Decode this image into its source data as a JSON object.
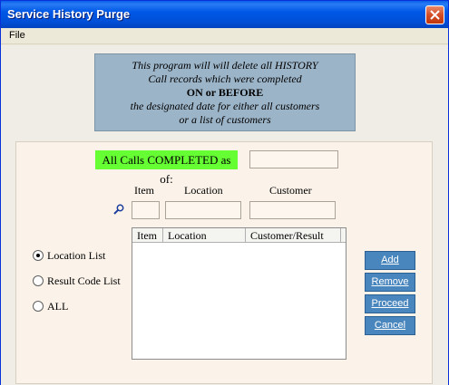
{
  "window": {
    "title": "Service History Purge"
  },
  "menu": {
    "file": "File"
  },
  "info": {
    "line1": "This program will will delete all HISTORY",
    "line2": "Call records which were completed",
    "line3": "ON or BEFORE",
    "line4": "the designated date for either all customers",
    "line5": "or a list of customers"
  },
  "form": {
    "calls_label": "All Calls COMPLETED as of:",
    "date_value": "",
    "headers": {
      "item": "Item",
      "location": "Location",
      "customer": "Customer"
    },
    "fields": {
      "item": "",
      "location": "",
      "customer": ""
    }
  },
  "list": {
    "columns": [
      "Item",
      "Location",
      "Customer/Result"
    ],
    "rows": []
  },
  "options": [
    {
      "label": "Location List",
      "selected": true
    },
    {
      "label": "Result Code List",
      "selected": false
    },
    {
      "label": "ALL",
      "selected": false
    }
  ],
  "buttons": {
    "add": "Add",
    "remove": "Remove",
    "proceed": "Proceed",
    "cancel": "Cancel"
  },
  "colors": {
    "title_bar": "#0058e6",
    "info_panel": "#9cb4c8",
    "highlight": "#66ff33",
    "button": "#4a86be"
  },
  "icons": {
    "close": "close-icon",
    "find": "magnifier-icon"
  }
}
